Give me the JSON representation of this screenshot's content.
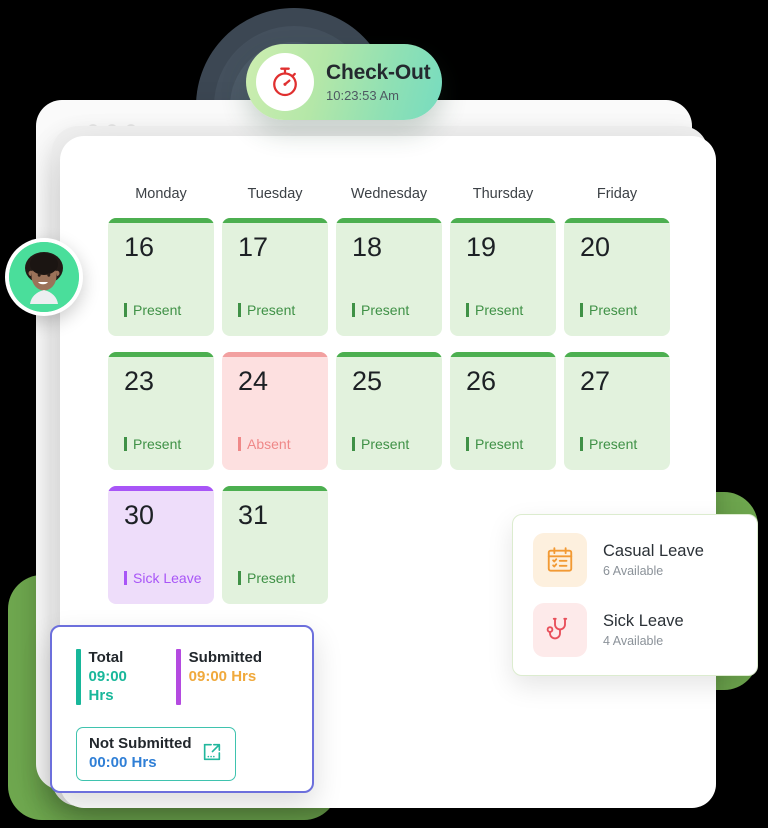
{
  "checkout": {
    "icon": "stopwatch-icon",
    "label": "Check-Out",
    "time": "10:23:53 Am"
  },
  "window_dots": [
    "dot",
    "dot",
    "dot"
  ],
  "calendar": {
    "day_headers": [
      "Monday",
      "Tuesday",
      "Wednesday",
      "Thursday",
      "Friday"
    ],
    "cells": [
      {
        "date": "16",
        "status": "Present",
        "state": "present"
      },
      {
        "date": "17",
        "status": "Present",
        "state": "present"
      },
      {
        "date": "18",
        "status": "Present",
        "state": "present"
      },
      {
        "date": "19",
        "status": "Present",
        "state": "present"
      },
      {
        "date": "20",
        "status": "Present",
        "state": "present"
      },
      {
        "date": "23",
        "status": "Present",
        "state": "present"
      },
      {
        "date": "24",
        "status": "Absent",
        "state": "absent"
      },
      {
        "date": "25",
        "status": "Present",
        "state": "present"
      },
      {
        "date": "26",
        "status": "Present",
        "state": "present"
      },
      {
        "date": "27",
        "status": "Present",
        "state": "present"
      },
      {
        "date": "30",
        "status": "Sick Leave",
        "state": "sick"
      },
      {
        "date": "31",
        "status": "Present",
        "state": "present"
      }
    ],
    "colors": {
      "present_bg": "#e2f2dd",
      "present_bar": "#4caf50",
      "present_text": "#3f9146",
      "absent_bg": "#fde0e0",
      "absent_bar": "#f2a0a0",
      "absent_text": "#ef8888",
      "sick_bg": "#eeddfa",
      "sick_bar": "#a855f7",
      "sick_text": "#a855f7"
    }
  },
  "leave_card": {
    "items": [
      {
        "icon": "calendar-checklist-icon",
        "title": "Casual Leave",
        "available": "6 Available",
        "accent": "#f29a34"
      },
      {
        "icon": "stethoscope-icon",
        "title": "Sick Leave",
        "available": "4 Available",
        "accent": "#e8505b"
      }
    ]
  },
  "hours_card": {
    "total": {
      "label": "Total",
      "value": "09:00 Hrs",
      "bar_color": "#18b79a",
      "value_color": "#18b79a"
    },
    "submitted": {
      "label": "Submitted",
      "value": "09:00 Hrs",
      "bar_color": "#b44ae0",
      "value_color": "#f0a93c"
    },
    "not_submitted": {
      "label": "Not Submitted",
      "value": "00:00 Hrs",
      "icon": "export-icon",
      "value_color": "#2f7fd6"
    }
  },
  "avatar": {
    "name": "user-avatar",
    "ring_color": "#4ade9b"
  }
}
